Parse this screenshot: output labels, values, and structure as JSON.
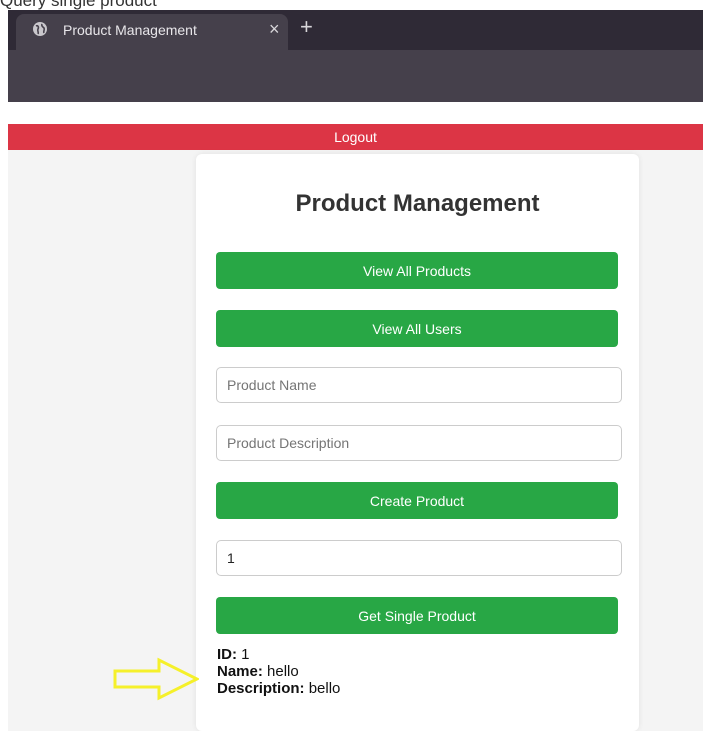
{
  "caption": "Query single product",
  "browser": {
    "tab_title": "Product Management",
    "tab_close": "×",
    "new_tab": "+"
  },
  "page": {
    "logout_label": "Logout",
    "title": "Product Management",
    "view_all_products_label": "View All Products",
    "view_all_users_label": "View All Users",
    "product_name_placeholder": "Product Name",
    "product_description_placeholder": "Product Description",
    "create_product_label": "Create Product",
    "product_id_value": "1",
    "get_single_product_label": "Get Single Product",
    "result": {
      "id_label": "ID:",
      "id_value": "1",
      "name_label": "Name:",
      "name_value": "hello",
      "description_label": "Description:",
      "description_value": "bello"
    }
  },
  "colors": {
    "accent_green": "#28a745",
    "logout_red": "#dc3545",
    "annotation_arrow": "#f5f02a"
  },
  "icons": {
    "tab_icon": "globe-icon",
    "annotation": "arrow-right-icon"
  }
}
